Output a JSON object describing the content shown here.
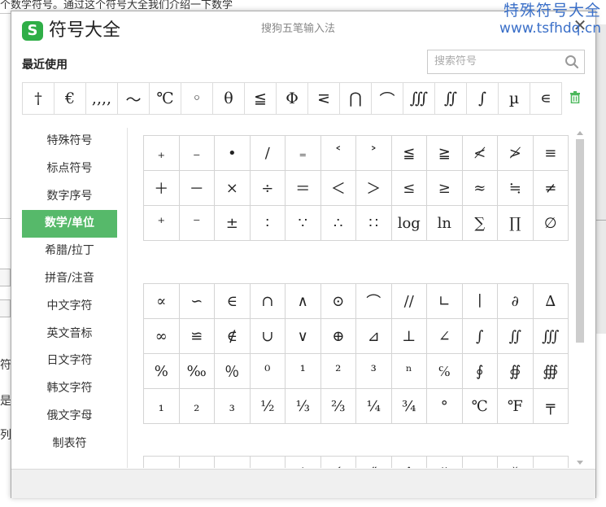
{
  "background": {
    "top_text": "个数学符号。通过这个符号大全我们介绍一下数学",
    "left_fragments": [
      "符号",
      "是",
      "列"
    ]
  },
  "watermark": {
    "line1": "特殊符号大全",
    "line2": "www.tsfhdq.cn"
  },
  "dialog": {
    "logo_letter": "S",
    "title": "符号大全",
    "subtitle": "搜狗五笔输入法",
    "close": "✕",
    "recent_label": "最近使用",
    "search_placeholder": "搜索符号",
    "recent": [
      "†",
      "€",
      ",,,,",
      "～",
      "℃",
      "◦",
      "θ",
      "≦",
      "Φ",
      "⋜",
      "⋂",
      "⌒",
      "∭",
      "∬",
      "∫",
      "µ",
      "∊"
    ],
    "sidebar": [
      "特殊符号",
      "标点符号",
      "数字序号",
      "数学/单位",
      "希腊/拉丁",
      "拼音/注音",
      "中文字符",
      "英文音标",
      "日文字符",
      "韩文字符",
      "俄文字母",
      "制表符"
    ],
    "active_sidebar": "数学/单位",
    "table1": [
      [
        "₊",
        "₋",
        "•",
        "∕",
        "₌",
        "˂",
        "˃",
        "≦",
        "≧",
        "≮",
        "≯",
        "≡"
      ],
      [
        "＋",
        "－",
        "×",
        "÷",
        "＝",
        "＜",
        "＞",
        "≤",
        "≥",
        "≈",
        "≒",
        "≠"
      ],
      [
        "⁺",
        "⁻",
        "±",
        "∶",
        "∵",
        "∴",
        "∷",
        "log",
        "ln",
        "∑",
        "∏",
        "∅"
      ]
    ],
    "table2": [
      [
        "∝",
        "∽",
        "∈",
        "∩",
        "∧",
        "⊙",
        "⌒",
        "//",
        "∟",
        "∣",
        "∂",
        "∆"
      ],
      [
        "∞",
        "≌",
        "∉",
        "∪",
        "∨",
        "⊕",
        "⊿",
        "⊥",
        "∠",
        "∫",
        "∬",
        "∭"
      ],
      [
        "%",
        "‰",
        "％",
        "⁰",
        "¹",
        "²",
        "³",
        "ⁿ",
        "℅",
        "∮",
        "∯",
        "∰"
      ],
      [
        "₁",
        "₂",
        "₃",
        "½",
        "⅓",
        "⅔",
        "¼",
        "¾",
        "°",
        "℃",
        "℉",
        "╤"
      ]
    ],
    "table3": [
      [
        "",
        "ˎ",
        "",
        "",
        "ˈ",
        "ˊ",
        "˝",
        "ˆ",
        "˘",
        "",
        "ˇ",
        ""
      ]
    ]
  },
  "colors": {
    "accent": "#56b96a",
    "logo": "#2fae47",
    "watermark": "#3a6fc8",
    "trash": "#4cb85c"
  }
}
